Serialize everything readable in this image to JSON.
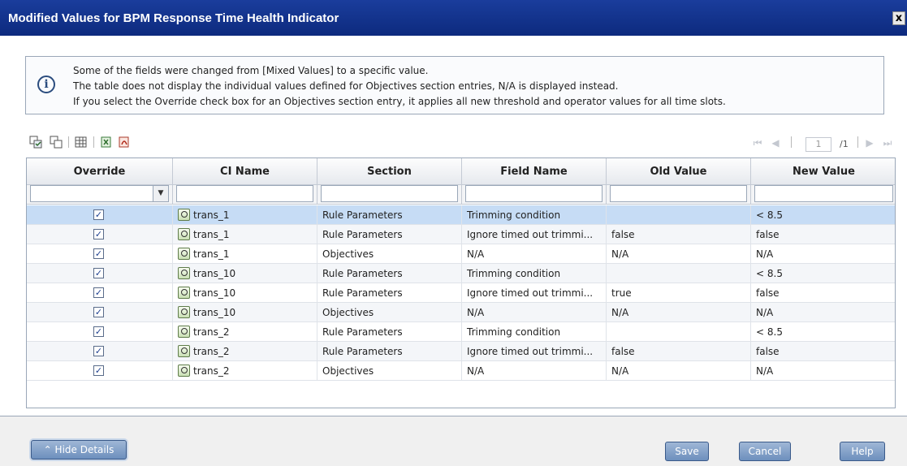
{
  "window": {
    "title": "Modified Values for BPM Response Time Health Indicator",
    "close_label": "x"
  },
  "info": {
    "icon": "info-icon",
    "lines": [
      "Some of the fields were changed from [Mixed Values] to a specific value.",
      "The table does not display the individual values defined for Objectives section entries, N/A is displayed instead.",
      "If you select the Override check box for an Objectives section entry, it applies all new threshold and operator values for all time slots."
    ]
  },
  "pager": {
    "page": "1",
    "total": "/1"
  },
  "table": {
    "columns": [
      "Override",
      "CI Name",
      "Section",
      "Field Name",
      "Old Value",
      "New Value"
    ],
    "rows": [
      {
        "override": true,
        "ci_name": "trans_1",
        "section": "Rule Parameters",
        "field_name": "Trimming condition",
        "old_value": "",
        "new_value": "< 8.5"
      },
      {
        "override": true,
        "ci_name": "trans_1",
        "section": "Rule Parameters",
        "field_name": "Ignore timed out trimmi...",
        "old_value": "false",
        "new_value": "false"
      },
      {
        "override": true,
        "ci_name": "trans_1",
        "section": "Objectives",
        "field_name": "N/A",
        "old_value": "N/A",
        "new_value": "N/A"
      },
      {
        "override": true,
        "ci_name": "trans_10",
        "section": "Rule Parameters",
        "field_name": "Trimming condition",
        "old_value": "",
        "new_value": "< 8.5"
      },
      {
        "override": true,
        "ci_name": "trans_10",
        "section": "Rule Parameters",
        "field_name": "Ignore timed out trimmi...",
        "old_value": "true",
        "new_value": "false"
      },
      {
        "override": true,
        "ci_name": "trans_10",
        "section": "Objectives",
        "field_name": "N/A",
        "old_value": "N/A",
        "new_value": "N/A"
      },
      {
        "override": true,
        "ci_name": "trans_2",
        "section": "Rule Parameters",
        "field_name": "Trimming condition",
        "old_value": "",
        "new_value": "< 8.5"
      },
      {
        "override": true,
        "ci_name": "trans_2",
        "section": "Rule Parameters",
        "field_name": "Ignore timed out trimmi...",
        "old_value": "false",
        "new_value": "false"
      },
      {
        "override": true,
        "ci_name": "trans_2",
        "section": "Objectives",
        "field_name": "N/A",
        "old_value": "N/A",
        "new_value": "N/A"
      }
    ]
  },
  "footer": {
    "hide_details_label": "Hide Details",
    "save_label": "Save",
    "cancel_label": "Cancel",
    "help_label": "Help"
  }
}
